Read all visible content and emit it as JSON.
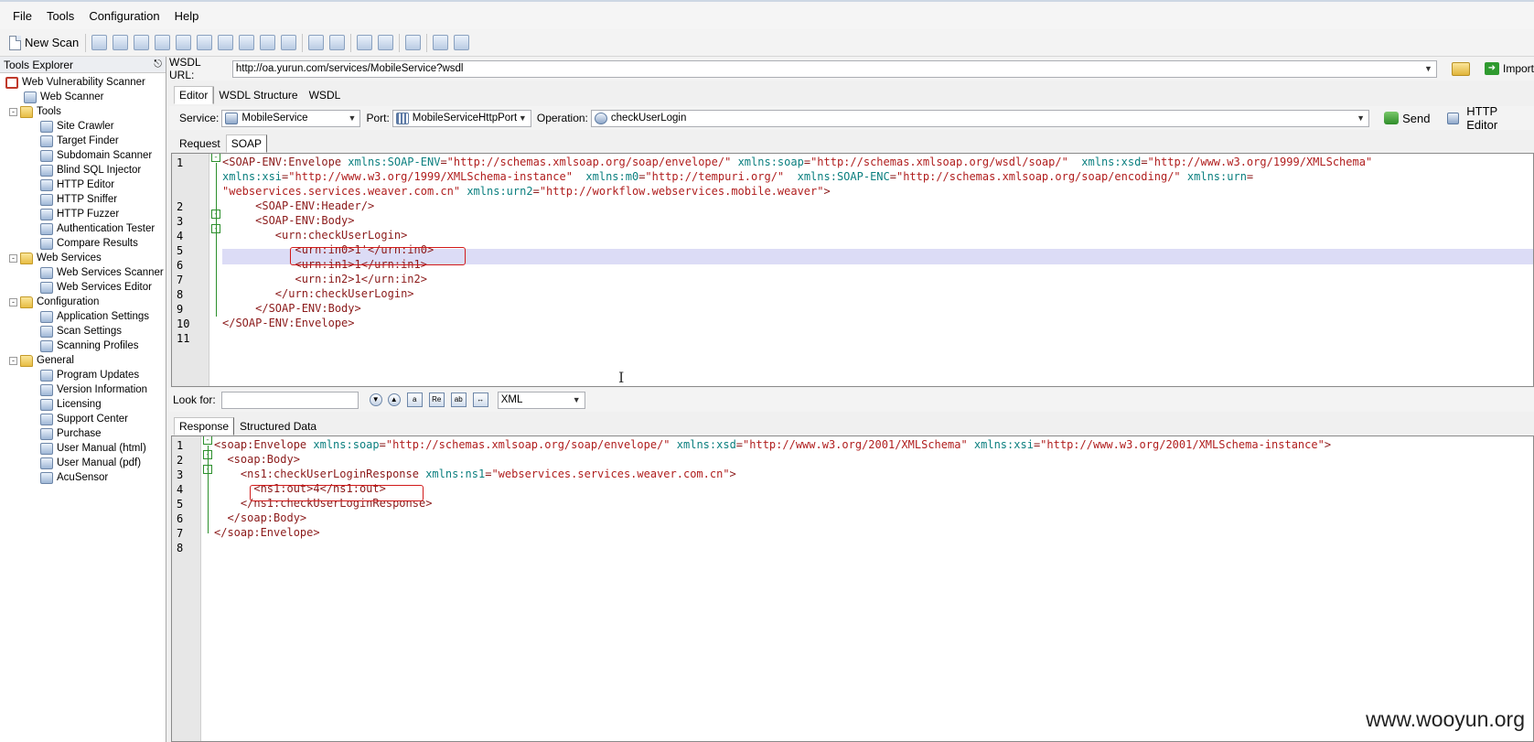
{
  "menu": [
    "File",
    "Tools",
    "Configuration",
    "Help"
  ],
  "toolbar": {
    "new_scan": "New Scan"
  },
  "explorer": {
    "title": "Tools Explorer",
    "items": [
      {
        "label": "Web Vulnerability Scanner",
        "level": 0,
        "type": "root"
      },
      {
        "label": "Web Scanner",
        "level": 1,
        "type": "item"
      },
      {
        "label": "Tools",
        "level": 0,
        "type": "folder"
      },
      {
        "label": "Site Crawler",
        "level": 2,
        "type": "item"
      },
      {
        "label": "Target Finder",
        "level": 2,
        "type": "item"
      },
      {
        "label": "Subdomain Scanner",
        "level": 2,
        "type": "item"
      },
      {
        "label": "Blind SQL Injector",
        "level": 2,
        "type": "item"
      },
      {
        "label": "HTTP Editor",
        "level": 2,
        "type": "item"
      },
      {
        "label": "HTTP Sniffer",
        "level": 2,
        "type": "item"
      },
      {
        "label": "HTTP Fuzzer",
        "level": 2,
        "type": "item"
      },
      {
        "label": "Authentication Tester",
        "level": 2,
        "type": "item"
      },
      {
        "label": "Compare Results",
        "level": 2,
        "type": "item"
      },
      {
        "label": "Web Services",
        "level": 0,
        "type": "folder"
      },
      {
        "label": "Web Services Scanner",
        "level": 2,
        "type": "item"
      },
      {
        "label": "Web Services Editor",
        "level": 2,
        "type": "item"
      },
      {
        "label": "Configuration",
        "level": 0,
        "type": "folder"
      },
      {
        "label": "Application Settings",
        "level": 2,
        "type": "item"
      },
      {
        "label": "Scan Settings",
        "level": 2,
        "type": "item"
      },
      {
        "label": "Scanning Profiles",
        "level": 2,
        "type": "item"
      },
      {
        "label": "General",
        "level": 0,
        "type": "folder"
      },
      {
        "label": "Program Updates",
        "level": 2,
        "type": "item"
      },
      {
        "label": "Version Information",
        "level": 2,
        "type": "item"
      },
      {
        "label": "Licensing",
        "level": 2,
        "type": "item"
      },
      {
        "label": "Support Center",
        "level": 2,
        "type": "item"
      },
      {
        "label": "Purchase",
        "level": 2,
        "type": "item"
      },
      {
        "label": "User Manual (html)",
        "level": 2,
        "type": "item"
      },
      {
        "label": "User Manual (pdf)",
        "level": 2,
        "type": "item"
      },
      {
        "label": "AcuSensor",
        "level": 2,
        "type": "item"
      }
    ]
  },
  "wsdl": {
    "label": "WSDL URL:",
    "value": "http://oa.yurun.com/services/MobileService?wsdl",
    "import_label": "Import"
  },
  "editor_tabs": [
    "Editor",
    "WSDL Structure",
    "WSDL"
  ],
  "service": {
    "service_label": "Service:",
    "service_value": "MobileService",
    "port_label": "Port:",
    "port_value": "MobileServiceHttpPort",
    "operation_label": "Operation:",
    "operation_value": "checkUserLogin",
    "send_label": "Send",
    "http_editor_label": "HTTP Editor"
  },
  "request_tabs": [
    "Request",
    "SOAP"
  ],
  "request_lines": [
    {
      "n": "1",
      "segs": [
        [
          "tg",
          "<SOAP-ENV:Envelope "
        ],
        [
          "an",
          "xmlns:SOAP-ENV"
        ],
        [
          "tg",
          "="
        ],
        [
          "av",
          "\"http://schemas.xmlsoap.org/soap/envelope/\""
        ],
        [
          "tg",
          " "
        ],
        [
          "an",
          "xmlns:soap"
        ],
        [
          "tg",
          "="
        ],
        [
          "av",
          "\"http://schemas.xmlsoap.org/wsdl/soap/\""
        ],
        [
          "tg",
          "  "
        ],
        [
          "an",
          "xmlns:xsd"
        ],
        [
          "tg",
          "="
        ],
        [
          "av",
          "\"http://www.w3.org/1999/XMLSchema\""
        ]
      ]
    },
    {
      "n": "",
      "segs": [
        [
          "an",
          "xmlns:xsi"
        ],
        [
          "tg",
          "="
        ],
        [
          "av",
          "\"http://www.w3.org/1999/XMLSchema-instance\""
        ],
        [
          "tg",
          "  "
        ],
        [
          "an",
          "xmlns:m0"
        ],
        [
          "tg",
          "="
        ],
        [
          "av",
          "\"http://tempuri.org/\""
        ],
        [
          "tg",
          "  "
        ],
        [
          "an",
          "xmlns:SOAP-ENC"
        ],
        [
          "tg",
          "="
        ],
        [
          "av",
          "\"http://schemas.xmlsoap.org/soap/encoding/\""
        ],
        [
          "tg",
          " "
        ],
        [
          "an",
          "xmlns:urn"
        ],
        [
          "tg",
          "="
        ]
      ]
    },
    {
      "n": "",
      "segs": [
        [
          "av",
          "\"webservices.services.weaver.com.cn\""
        ],
        [
          "tg",
          " "
        ],
        [
          "an",
          "xmlns:urn2"
        ],
        [
          "tg",
          "="
        ],
        [
          "av",
          "\"http://workflow.webservices.mobile.weaver\""
        ],
        [
          "tg",
          ">"
        ]
      ]
    },
    {
      "n": "2",
      "segs": [
        [
          "tg",
          "     <SOAP-ENV:Header/>"
        ]
      ]
    },
    {
      "n": "3",
      "segs": [
        [
          "tg",
          "     <SOAP-ENV:Body>"
        ]
      ]
    },
    {
      "n": "4",
      "segs": [
        [
          "tg",
          "        <urn:checkUserLogin>"
        ]
      ]
    },
    {
      "n": "5",
      "segs": [
        [
          "tg",
          "           <urn:in0>1'</urn:in0>"
        ]
      ]
    },
    {
      "n": "6",
      "segs": [
        [
          "tg",
          "           <urn:in1>1</urn:in1>"
        ]
      ]
    },
    {
      "n": "7",
      "segs": [
        [
          "tg",
          "           <urn:in2>1</urn:in2>"
        ]
      ]
    },
    {
      "n": "8",
      "segs": [
        [
          "tg",
          "        </urn:checkUserLogin>"
        ]
      ]
    },
    {
      "n": "9",
      "segs": [
        [
          "tg",
          "     </SOAP-ENV:Body>"
        ]
      ]
    },
    {
      "n": "10",
      "segs": [
        [
          "tg",
          "</SOAP-ENV:Envelope>"
        ]
      ]
    },
    {
      "n": "11",
      "segs": []
    }
  ],
  "lookfor": {
    "label": "Look for:",
    "value": "",
    "format": "XML"
  },
  "response_tabs": [
    "Response",
    "Structured Data"
  ],
  "response_lines": [
    {
      "n": "1",
      "segs": [
        [
          "tg",
          "<soap:Envelope "
        ],
        [
          "an",
          "xmlns:soap"
        ],
        [
          "tg",
          "="
        ],
        [
          "av",
          "\"http://schemas.xmlsoap.org/soap/envelope/\""
        ],
        [
          "tg",
          " "
        ],
        [
          "an",
          "xmlns:xsd"
        ],
        [
          "tg",
          "="
        ],
        [
          "av",
          "\"http://www.w3.org/2001/XMLSchema\""
        ],
        [
          "tg",
          " "
        ],
        [
          "an",
          "xmlns:xsi"
        ],
        [
          "tg",
          "="
        ],
        [
          "av",
          "\"http://www.w3.org/2001/XMLSchema-instance\""
        ],
        [
          "tg",
          ">"
        ]
      ]
    },
    {
      "n": "2",
      "segs": [
        [
          "tg",
          "  <soap:Body>"
        ]
      ]
    },
    {
      "n": "3",
      "segs": [
        [
          "tg",
          "    <ns1:checkUserLoginResponse "
        ],
        [
          "an",
          "xmlns:ns1"
        ],
        [
          "tg",
          "="
        ],
        [
          "av",
          "\"webservices.services.weaver.com.cn\""
        ],
        [
          "tg",
          ">"
        ]
      ]
    },
    {
      "n": "4",
      "segs": [
        [
          "tg",
          "      <ns1:out>4</ns1:out>"
        ]
      ]
    },
    {
      "n": "5",
      "segs": [
        [
          "tg",
          "    </ns1:checkUserLoginResponse>"
        ]
      ]
    },
    {
      "n": "6",
      "segs": [
        [
          "tg",
          "  </soap:Body>"
        ]
      ]
    },
    {
      "n": "7",
      "segs": [
        [
          "tg",
          "</soap:Envelope>"
        ]
      ]
    },
    {
      "n": "8",
      "segs": []
    }
  ],
  "watermark": "www.wooyun.org",
  "colors": {
    "tag": "#8b1a1a",
    "attr_name": "#0b7f7f",
    "attr_value": "#b01e1e",
    "highlight": "#dcdcf6",
    "annotation": "#d11a1a"
  }
}
